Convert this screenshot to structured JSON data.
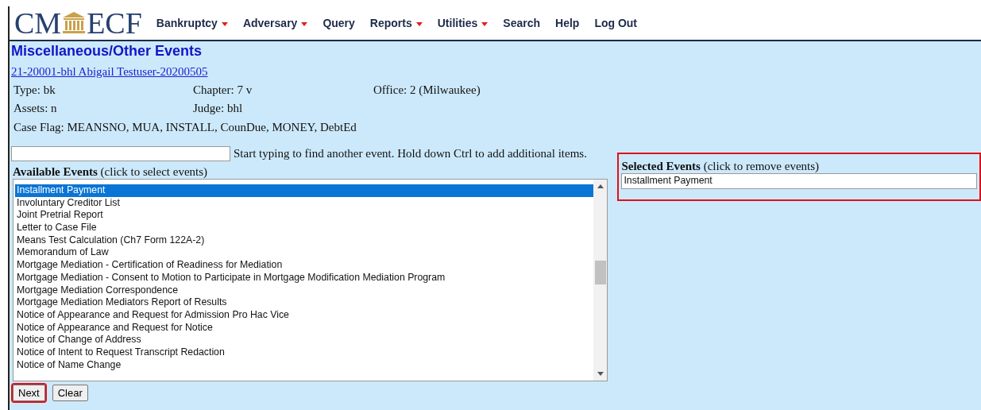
{
  "logo": {
    "left": "CM",
    "right": "ECF"
  },
  "menu": [
    {
      "label": "Bankruptcy",
      "dropdown": true
    },
    {
      "label": "Adversary",
      "dropdown": true
    },
    {
      "label": "Query",
      "dropdown": false
    },
    {
      "label": "Reports",
      "dropdown": true
    },
    {
      "label": "Utilities",
      "dropdown": true
    },
    {
      "label": "Search",
      "dropdown": false
    },
    {
      "label": "Help",
      "dropdown": false
    },
    {
      "label": "Log Out",
      "dropdown": false
    }
  ],
  "page_title": "Miscellaneous/Other Events",
  "case_link": "21-20001-bhl Abigail Testuser-20200505",
  "case_info": [
    [
      "Type: bk",
      "Chapter: 7 v",
      "Office: 2 (Milwaukee)"
    ],
    [
      "Assets: n",
      "Judge: bhl"
    ]
  ],
  "case_flag": "Case Flag: MEANSNO, MUA, INSTALL, CounDue, MONEY, DebtEd",
  "search_hint": "Start typing to find another event. Hold down Ctrl to add additional items.",
  "available": {
    "heading": "Available Events",
    "note": "(click to select events)",
    "items": [
      {
        "label": "Installment Payment",
        "selected": true
      },
      {
        "label": "Involuntary Creditor List",
        "selected": false
      },
      {
        "label": "Joint Pretrial Report",
        "selected": false
      },
      {
        "label": "Letter to Case File",
        "selected": false
      },
      {
        "label": "Means Test Calculation (Ch7 Form 122A-2)",
        "selected": false
      },
      {
        "label": "Memorandum of Law",
        "selected": false
      },
      {
        "label": "Mortgage Mediation - Certification of Readiness for Mediation",
        "selected": false
      },
      {
        "label": "Mortgage Mediation - Consent to Motion to Participate in Mortgage Modification Mediation Program",
        "selected": false
      },
      {
        "label": "Mortgage Mediation Correspondence",
        "selected": false
      },
      {
        "label": "Mortgage Mediation Mediators Report of Results",
        "selected": false
      },
      {
        "label": "Notice of Appearance and Request for Admission Pro Hac Vice",
        "selected": false
      },
      {
        "label": "Notice of Appearance and Request for Notice",
        "selected": false
      },
      {
        "label": "Notice of Change of Address",
        "selected": false
      },
      {
        "label": "Notice of Intent to Request Transcript Redaction",
        "selected": false
      },
      {
        "label": "Notice of Name Change",
        "selected": false
      }
    ]
  },
  "selected_events": {
    "heading": "Selected Events",
    "note": "(click to remove events)",
    "items": [
      "Installment Payment"
    ],
    "highlighted": true
  },
  "buttons": [
    {
      "label": "Next",
      "highlighted": true
    },
    {
      "label": "Clear",
      "highlighted": false
    }
  ]
}
